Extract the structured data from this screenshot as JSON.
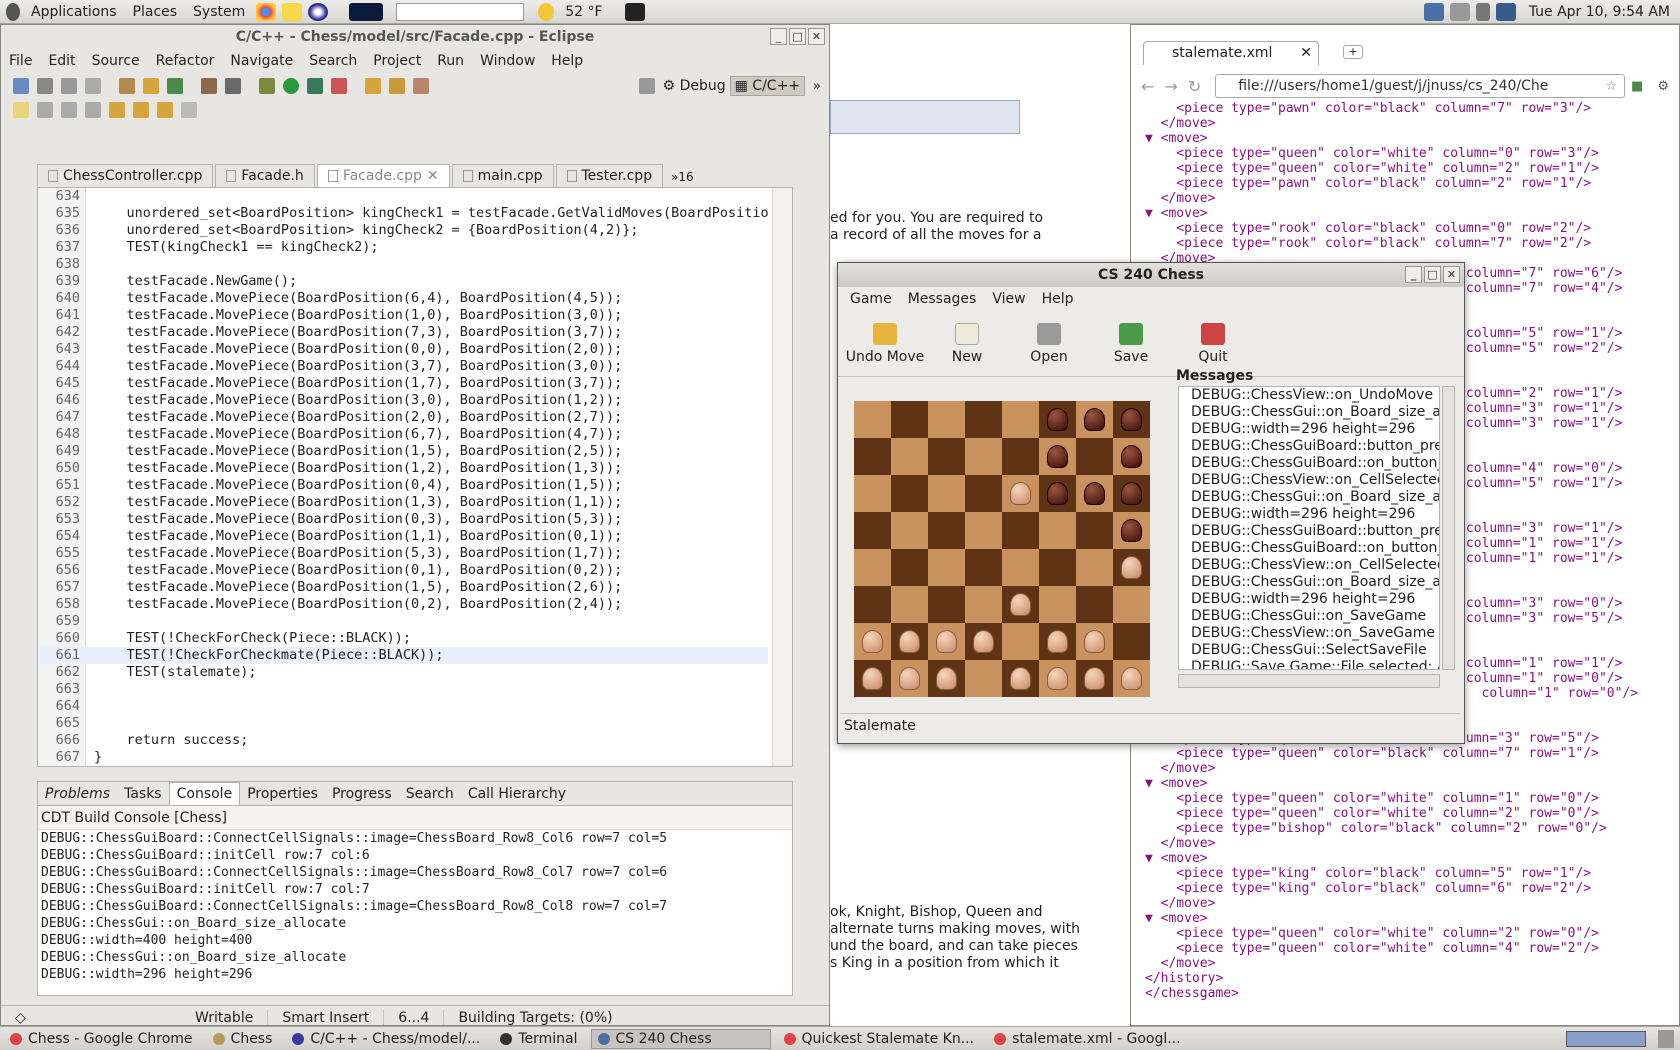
{
  "panel": {
    "menus": [
      "Applications",
      "Places",
      "System"
    ],
    "weather": "52 °F",
    "clock": "Tue Apr 10,  9:54 AM"
  },
  "eclipse": {
    "title": "C/C++ - Chess/model/src/Facade.cpp - Eclipse",
    "menus": [
      "File",
      "Edit",
      "Source",
      "Refactor",
      "Navigate",
      "Search",
      "Project",
      "Run",
      "Window",
      "Help"
    ],
    "perspectives": [
      "Debug",
      "C/C++"
    ],
    "tabs": [
      "ChessController.cpp",
      "Facade.h",
      "Facade.cpp",
      "main.cpp",
      "Tester.cpp"
    ],
    "tab_overflow": "»16",
    "code_lines": [
      {
        "n": "634",
        "t": ""
      },
      {
        "n": "635",
        "t": "    unordered_set<BoardPosition> kingCheck1 = testFacade.GetValidMoves(BoardPosition("
      },
      {
        "n": "636",
        "t": "    unordered_set<BoardPosition> kingCheck2 = {BoardPosition(4,2)};"
      },
      {
        "n": "637",
        "t": "    TEST(kingCheck1 == kingCheck2);"
      },
      {
        "n": "638",
        "t": ""
      },
      {
        "n": "639",
        "t": "    testFacade.NewGame();"
      },
      {
        "n": "640",
        "t": "    testFacade.MovePiece(BoardPosition(6,4), BoardPosition(4,5));"
      },
      {
        "n": "641",
        "t": "    testFacade.MovePiece(BoardPosition(1,0), BoardPosition(3,0));"
      },
      {
        "n": "642",
        "t": "    testFacade.MovePiece(BoardPosition(7,3), BoardPosition(3,7));"
      },
      {
        "n": "643",
        "t": "    testFacade.MovePiece(BoardPosition(0,0), BoardPosition(2,0));"
      },
      {
        "n": "644",
        "t": "    testFacade.MovePiece(BoardPosition(3,7), BoardPosition(3,0));"
      },
      {
        "n": "645",
        "t": "    testFacade.MovePiece(BoardPosition(1,7), BoardPosition(3,7));"
      },
      {
        "n": "646",
        "t": "    testFacade.MovePiece(BoardPosition(3,0), BoardPosition(1,2));"
      },
      {
        "n": "647",
        "t": "    testFacade.MovePiece(BoardPosition(2,0), BoardPosition(2,7));"
      },
      {
        "n": "648",
        "t": "    testFacade.MovePiece(BoardPosition(6,7), BoardPosition(4,7));"
      },
      {
        "n": "649",
        "t": "    testFacade.MovePiece(BoardPosition(1,5), BoardPosition(2,5));"
      },
      {
        "n": "650",
        "t": "    testFacade.MovePiece(BoardPosition(1,2), BoardPosition(1,3));"
      },
      {
        "n": "651",
        "t": "    testFacade.MovePiece(BoardPosition(0,4), BoardPosition(1,5));"
      },
      {
        "n": "652",
        "t": "    testFacade.MovePiece(BoardPosition(1,3), BoardPosition(1,1));"
      },
      {
        "n": "653",
        "t": "    testFacade.MovePiece(BoardPosition(0,3), BoardPosition(5,3));"
      },
      {
        "n": "654",
        "t": "    testFacade.MovePiece(BoardPosition(1,1), BoardPosition(0,1));"
      },
      {
        "n": "655",
        "t": "    testFacade.MovePiece(BoardPosition(5,3), BoardPosition(1,7));"
      },
      {
        "n": "656",
        "t": "    testFacade.MovePiece(BoardPosition(0,1), BoardPosition(0,2));"
      },
      {
        "n": "657",
        "t": "    testFacade.MovePiece(BoardPosition(1,5), BoardPosition(2,6));"
      },
      {
        "n": "658",
        "t": "    testFacade.MovePiece(BoardPosition(0,2), BoardPosition(2,4));"
      },
      {
        "n": "659",
        "t": ""
      },
      {
        "n": "660",
        "t": "    TEST(!CheckForCheck(Piece::BLACK));"
      },
      {
        "n": "661",
        "t": "    TEST(!CheckForCheckmate(Piece::BLACK));"
      },
      {
        "n": "662",
        "t": "    TEST(stalemate);"
      },
      {
        "n": "663",
        "t": ""
      },
      {
        "n": "664",
        "t": ""
      },
      {
        "n": "665",
        "t": ""
      },
      {
        "n": "666",
        "t": "    return success;"
      },
      {
        "n": "667",
        "t": "}"
      }
    ],
    "console_tabs": [
      "Problems",
      "Tasks",
      "Console",
      "Properties",
      "Progress",
      "Search",
      "Call Hierarchy"
    ],
    "console_title": "CDT Build Console [Chess]",
    "console_lines": [
      "DEBUG::ChessGuiBoard::ConnectCellSignals::image=ChessBoard_Row8_Col6 row=7 col=5",
      "DEBUG::ChessGuiBoard::initCell row:7 col:6",
      "DEBUG::ChessGuiBoard::ConnectCellSignals::image=ChessBoard_Row8_Col7 row=7 col=6",
      "DEBUG::ChessGuiBoard::initCell row:7 col:7",
      "DEBUG::ChessGuiBoard::ConnectCellSignals::image=ChessBoard_Row8_Col8 row=7 col=7",
      "DEBUG::ChessGui::on_Board_size_allocate",
      "DEBUG::width=400 height=400",
      "DEBUG::ChessGui::on_Board_size_allocate",
      "DEBUG::width=296 height=296"
    ],
    "status": [
      "Writable",
      "Smart Insert",
      "6...4",
      "Building Targets: (0%)"
    ]
  },
  "bgdoc": {
    "line1": "ed for you. You are required to",
    "line2": "a record of all the moves for a",
    "line3": "ok, Knight, Bishop, Queen and",
    "line4": "alternate turns making moves, with",
    "line5": "und the board, and can take pieces",
    "line6": "s King in a position from which it"
  },
  "chess": {
    "title": "CS 240 Chess",
    "menus": [
      "Game",
      "Messages",
      "View",
      "Help"
    ],
    "toolbar": [
      "Undo Move",
      "New",
      "Open",
      "Save",
      "Quit"
    ],
    "messages_title": "Messages",
    "messages": [
      "DEBUG::ChessView::on_UndoMove",
      "DEBUG::ChessGui::on_Board_size_all",
      "DEBUG::width=296 height=296",
      "DEBUG::ChessGuiBoard::button_pres",
      "DEBUG::ChessGuiBoard::on_button_r",
      "DEBUG::ChessView::on_CellSelected",
      "DEBUG::ChessGui::on_Board_size_all",
      "DEBUG::width=296 height=296",
      "DEBUG::ChessGuiBoard::button_pres",
      "DEBUG::ChessGuiBoard::on_button_r",
      "DEBUG::ChessView::on_CellSelected",
      "DEBUG::ChessGui::on_Board_size_all",
      "DEBUG::width=296 height=296",
      "DEBUG::ChessGui::on_SaveGame",
      "DEBUG::ChessView::on_SaveGame",
      "DEBUG::ChessGui::SelectSaveFile",
      "DEBUG::Save Game::File selected: /u"
    ],
    "status": "Stalemate",
    "board": [
      [
        "",
        "",
        "",
        "",
        "",
        "b",
        "b",
        "b"
      ],
      [
        "",
        "",
        "",
        "",
        "",
        "b",
        "",
        "b"
      ],
      [
        "",
        "",
        "",
        "",
        "w",
        "b",
        "b",
        "b"
      ],
      [
        "",
        "",
        "",
        "",
        "",
        "",
        "",
        "b"
      ],
      [
        "",
        "",
        "",
        "",
        "",
        "",
        "",
        "w"
      ],
      [
        "",
        "",
        "",
        "",
        "w",
        "",
        "",
        ""
      ],
      [
        "w",
        "w",
        "w",
        "w",
        "",
        "w",
        "w",
        ""
      ],
      [
        "w",
        "w",
        "w",
        "",
        "w",
        "w",
        "w",
        "w"
      ]
    ]
  },
  "browser": {
    "tab_title": "stalemate.xml",
    "url": "file:///users/home1/guest/j/jnuss/cs_240/Che",
    "xml": [
      "    <piece type=\"pawn\" color=\"black\" column=\"7\" row=\"3\"/>",
      "  </move>",
      "▼ <move>",
      "    <piece type=\"queen\" color=\"white\" column=\"0\" row=\"3\"/>",
      "    <piece type=\"queen\" color=\"white\" column=\"2\" row=\"1\"/>",
      "    <piece type=\"pawn\" color=\"black\" column=\"2\" row=\"1\"/>",
      "  </move>",
      "▼ <move>",
      "    <piece type=\"rook\" color=\"black\" column=\"0\" row=\"2\"/>",
      "    <piece type=\"rook\" color=\"black\" column=\"7\" row=\"2\"/>",
      "  </move>",
      "                                         column=\"7\" row=\"6\"/>",
      "                                         column=\"7\" row=\"4\"/>",
      "",
      "",
      "                                         column=\"5\" row=\"1\"/>",
      "                                         column=\"5\" row=\"2\"/>",
      "",
      "",
      "                                         column=\"2\" row=\"1\"/>",
      "                                         column=\"3\" row=\"1\"/>",
      "                                         column=\"3\" row=\"1\"/>",
      "",
      "",
      "                                         column=\"4\" row=\"0\"/>",
      "                                         column=\"5\" row=\"1\"/>",
      "",
      "",
      "                                         column=\"3\" row=\"1\"/>",
      "                                         column=\"1\" row=\"1\"/>",
      "                                         column=\"1\" row=\"1\"/>",
      "",
      "",
      "                                         column=\"3\" row=\"0\"/>",
      "                                         column=\"3\" row=\"5\"/>",
      "",
      "",
      "                                         column=\"1\" row=\"1\"/>",
      "                                         column=\"1\" row=\"0\"/>",
      "                                           column=\"1\" row=\"0\"/>",
      "",
      "",
      "    <piece type=\"queen\" color=\"black\" column=\"3\" row=\"5\"/>",
      "    <piece type=\"queen\" color=\"black\" column=\"7\" row=\"1\"/>",
      "  </move>",
      "▼ <move>",
      "    <piece type=\"queen\" color=\"white\" column=\"1\" row=\"0\"/>",
      "    <piece type=\"queen\" color=\"white\" column=\"2\" row=\"0\"/>",
      "    <piece type=\"bishop\" color=\"black\" column=\"2\" row=\"0\"/>",
      "  </move>",
      "▼ <move>",
      "    <piece type=\"king\" color=\"black\" column=\"5\" row=\"1\"/>",
      "    <piece type=\"king\" color=\"black\" column=\"6\" row=\"2\"/>",
      "  </move>",
      "▼ <move>",
      "    <piece type=\"queen\" color=\"white\" column=\"2\" row=\"0\"/>",
      "    <piece type=\"queen\" color=\"white\" column=\"4\" row=\"2\"/>",
      "  </move>",
      "</history>",
      "</chessgame>"
    ]
  },
  "taskbar": [
    {
      "label": "Chess - Google Chrome",
      "color": "#d44"
    },
    {
      "label": "Chess",
      "color": "#b89b5a"
    },
    {
      "label": "C/C++ - Chess/model/...",
      "color": "#3a3aa0"
    },
    {
      "label": "Terminal",
      "color": "#333"
    },
    {
      "label": "CS 240 Chess",
      "color": "#4a6fa5"
    },
    {
      "label": "Quickest Stalemate Kn...",
      "color": "#d44"
    },
    {
      "label": "stalemate.xml - Googl...",
      "color": "#d44"
    }
  ],
  "colors": {
    "keyword": "#7f0055",
    "type": "#005032",
    "enum": "#0000c0",
    "board_light": "#c8935f",
    "board_dark": "#5e3316"
  }
}
